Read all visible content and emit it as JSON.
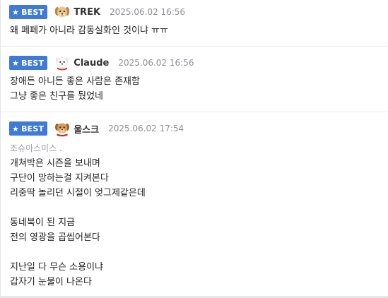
{
  "comments": [
    {
      "badge": "BEST",
      "nickname": "TREK",
      "date": "2025.06.02 16:56",
      "avatar_icon": "puppy-icon",
      "lines": [
        "왜 페페가 아니라 감동실화인 것이냐 ㅠㅠ"
      ]
    },
    {
      "badge": "BEST",
      "nickname": "Claude",
      "date": "2025.06.02 16:56",
      "avatar_icon": "white-puppy-icon",
      "lines": [
        "장애든 아니든 좋은 사람은 존재함",
        "그냥 좋은 친구를 뒀었네"
      ]
    },
    {
      "badge": "BEST",
      "nickname": "울스크",
      "date": "2025.06.02 17:54",
      "avatar_icon": "brown-puppy-icon",
      "reply_to": "조슈아스미스 .",
      "lines": [
        "개쳐박은 시즌을 보내며",
        "구단이 망하는걸 지켜본다",
        "리중딱 놀리던 시절이 엊그제같은데",
        "",
        "동네북이 된 지금",
        "전의 영광을 곱씹어본다",
        "",
        "지난일 다 무슨 소용이냐",
        "갑자기 눈물이 나온다"
      ]
    }
  ],
  "colors": {
    "badge": "#3f7bd6",
    "date": "#8c8f96",
    "reply_to": "#9a9ea6"
  }
}
